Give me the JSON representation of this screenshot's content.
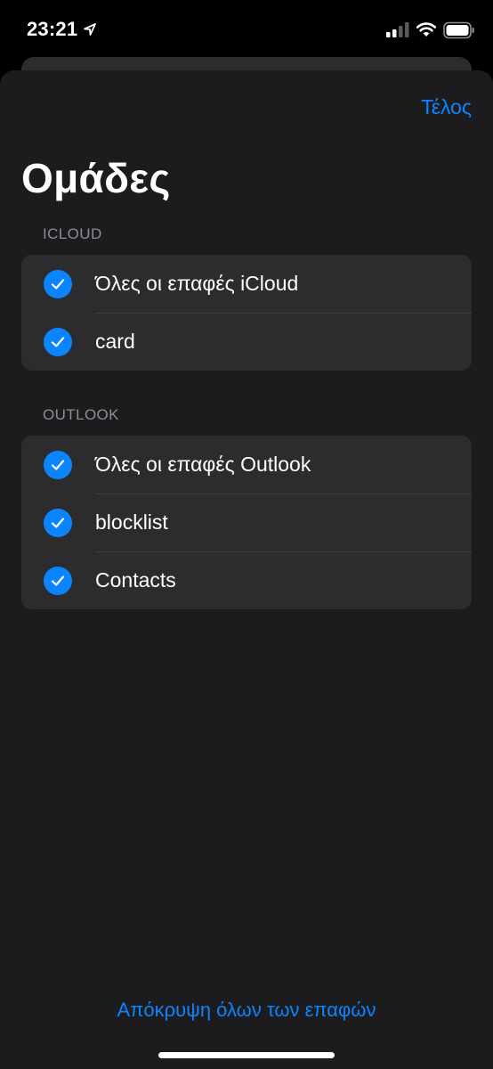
{
  "status_bar": {
    "time": "23:21",
    "icons": [
      "location-arrow-icon",
      "cellular-signal-icon",
      "wifi-icon",
      "battery-icon"
    ]
  },
  "header": {
    "done_label": "Τέλος",
    "title": "Ομάδες"
  },
  "sections": [
    {
      "header": "ICLOUD",
      "items": [
        {
          "label": "Όλες οι επαφές iCloud",
          "checked": true
        },
        {
          "label": "card",
          "checked": true
        }
      ]
    },
    {
      "header": "OUTLOOK",
      "items": [
        {
          "label": "Όλες οι επαφές Outlook",
          "checked": true
        },
        {
          "label": "blocklist",
          "checked": true
        },
        {
          "label": "Contacts",
          "checked": true
        }
      ]
    }
  ],
  "footer": {
    "hide_all_label": "Απόκρυψη όλων των επαφών"
  },
  "colors": {
    "accent": "#0a84ff",
    "background": "#1c1c1e",
    "group_background": "#2c2c2e",
    "secondary_text": "#8d8d93"
  }
}
